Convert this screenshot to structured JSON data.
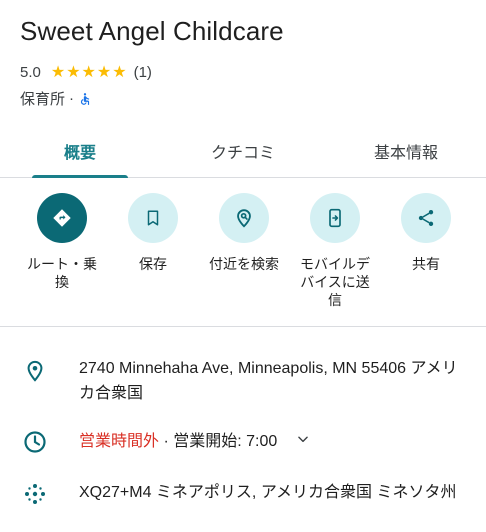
{
  "place": {
    "name": "Sweet Angel Childcare",
    "rating": "5.0",
    "stars": "★★★★★",
    "review_count": "(1)",
    "category": "保育所",
    "separator": "·"
  },
  "tabs": [
    {
      "label": "概要",
      "active": true
    },
    {
      "label": "クチコミ",
      "active": false
    },
    {
      "label": "基本情報",
      "active": false
    }
  ],
  "actions": [
    {
      "label_lines": [
        "ルート・乗",
        "換"
      ],
      "icon": "directions-icon"
    },
    {
      "label_lines": [
        "保存"
      ],
      "icon": "bookmark-icon"
    },
    {
      "label_lines": [
        "付近を検索"
      ],
      "icon": "nearby-search-icon"
    },
    {
      "label_lines": [
        "モバイルデ",
        "バイスに送",
        "信"
      ],
      "icon": "send-to-phone-icon"
    },
    {
      "label_lines": [
        "共有"
      ],
      "icon": "share-icon"
    }
  ],
  "info": {
    "address": "2740 Minnehaha Ave, Minneapolis, MN 55406 アメリカ合衆国",
    "hours_status": "営業時間外",
    "hours_separator": " · ",
    "hours_next": "営業開始: 7:00",
    "plus_code": "XQ27+M4 ミネアポリス, アメリカ合衆国 ミネソタ州"
  },
  "colors": {
    "accent": "#1a7f8a",
    "primary_button": "#0b6975",
    "action_bg": "#d4f0f3",
    "star": "#fbbc04",
    "closed": "#d93025"
  }
}
